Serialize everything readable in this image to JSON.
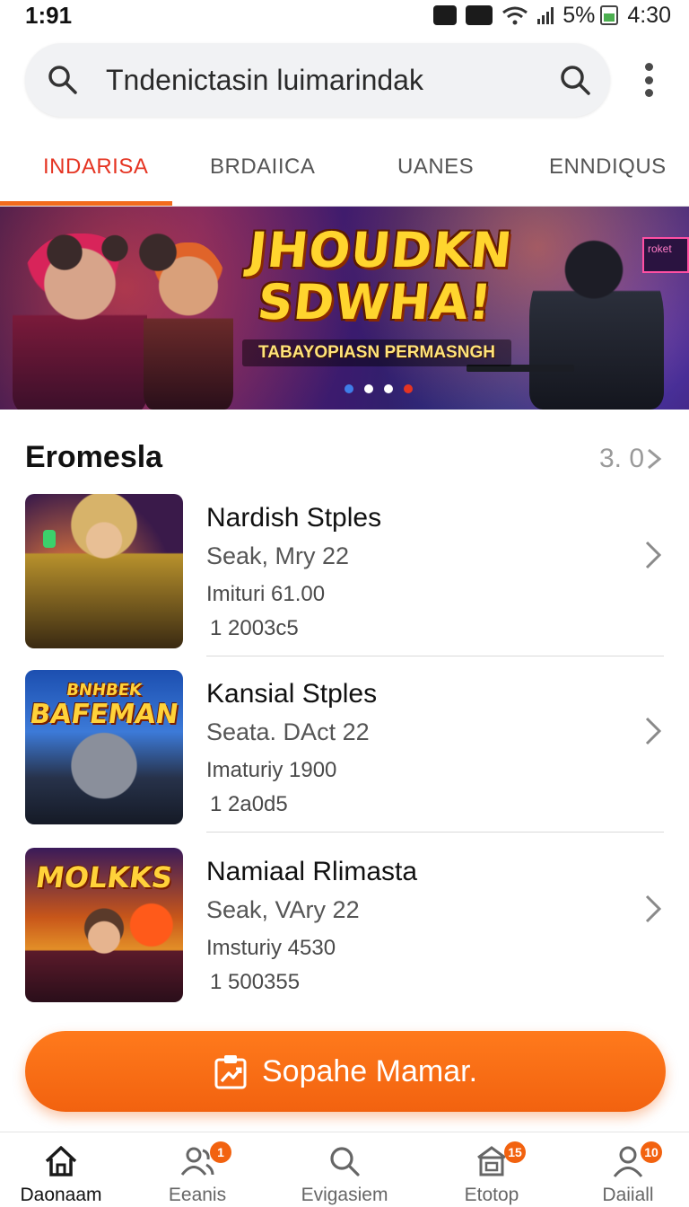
{
  "status_bar": {
    "time": "1:91",
    "battery_text": "5%",
    "clock": "4:30"
  },
  "search": {
    "placeholder": "Tndenictasin luimarindak"
  },
  "tabs": [
    {
      "label": "INDARISA",
      "active": true
    },
    {
      "label": "BRDAIICA",
      "active": false
    },
    {
      "label": "UANES",
      "active": false
    },
    {
      "label": "ENNDIQUS",
      "active": false
    }
  ],
  "banner": {
    "title_line1": "JHOUDKN",
    "title_line2": "SDWHA!",
    "subtitle": "TABAYOPIASN PERMASNGH",
    "sign_text": "roket",
    "dots": [
      {
        "color": "#3f7ee8"
      },
      {
        "color": "#ffffff"
      },
      {
        "color": "#ffffff"
      },
      {
        "color": "#e53422"
      }
    ]
  },
  "section": {
    "title": "Eromesla",
    "more_label": "3. 0"
  },
  "items": [
    {
      "title": "Nardish Stples",
      "date": "Seak, Mry 22",
      "meta": "Imituri 61.00",
      "code": "1 2003c5"
    },
    {
      "title": "Kansial Stples",
      "date": "Seata. DAct 22",
      "meta": "Imaturiy 1900",
      "code": "1 2a0d5",
      "thumb_text_1": "BNHBEK",
      "thumb_text_2": "BAFEMAN"
    },
    {
      "title": "Namiaal Rlimasta",
      "date": "Seak, VAry 22",
      "meta": "Imsturiy 4530",
      "code": "1 500355",
      "thumb_text_1": "MOLKKS"
    }
  ],
  "cta": {
    "label": "Sopahe Mamar."
  },
  "bottom_nav": [
    {
      "label": "Daonaam",
      "icon": "home-icon",
      "active": true
    },
    {
      "label": "Eeanis",
      "icon": "people-icon",
      "badge": "1"
    },
    {
      "label": "Evigasiem",
      "icon": "search-icon"
    },
    {
      "label": "Etotop",
      "icon": "shop-icon",
      "badge": "15"
    },
    {
      "label": "Daiiall",
      "icon": "profile-icon",
      "badge": "10"
    }
  ],
  "colors": {
    "accent": "#f2620f",
    "active_tab": "#e53422"
  }
}
